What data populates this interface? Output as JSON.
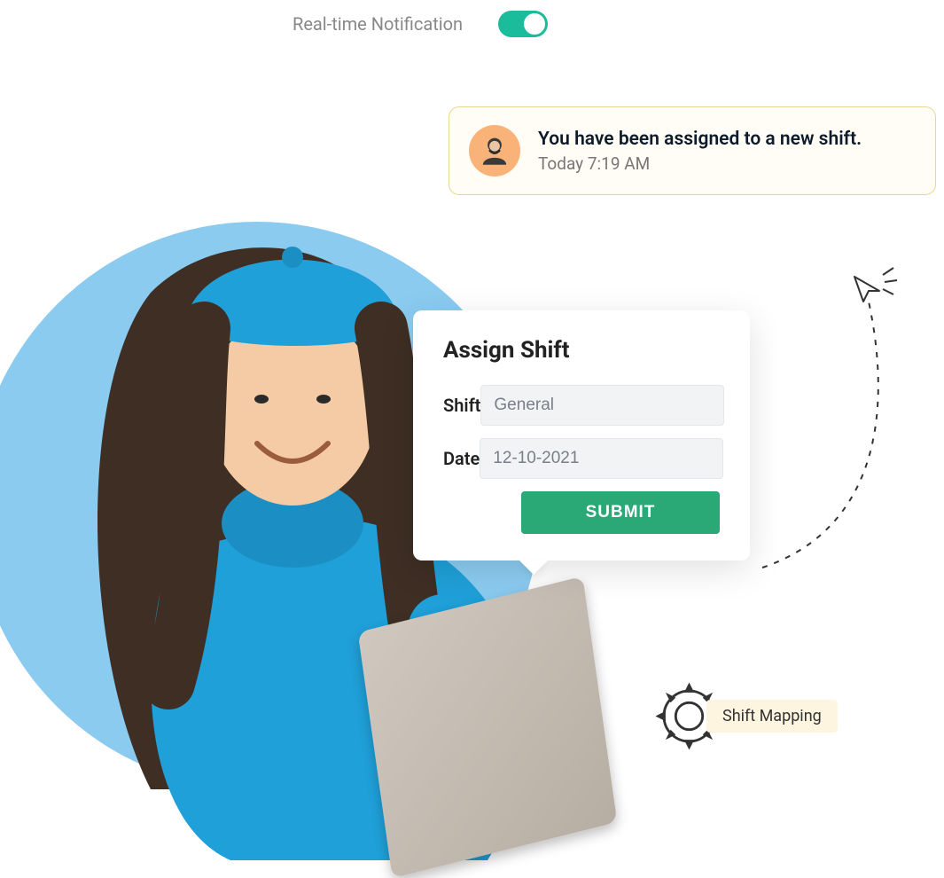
{
  "toggle": {
    "label": "Real-time Notification",
    "on": true
  },
  "notification": {
    "title": "You have been assigned to a new shift.",
    "time": "Today 7:19 AM"
  },
  "form": {
    "title": "Assign Shift",
    "shift_label": "Shift",
    "shift_value": "General",
    "date_label": "Date",
    "date_value": "12-10-2021",
    "submit_label": "SUBMIT"
  },
  "mapping": {
    "label": "Shift Mapping"
  }
}
